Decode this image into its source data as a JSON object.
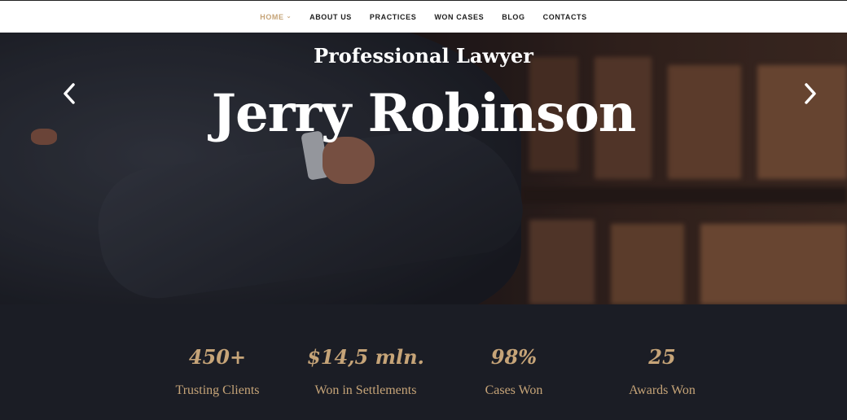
{
  "nav": {
    "items": [
      {
        "label": "HOME",
        "active": true,
        "has_dropdown": true
      },
      {
        "label": "ABOUT US",
        "active": false
      },
      {
        "label": "PRACTICES",
        "active": false
      },
      {
        "label": "WON CASES",
        "active": false
      },
      {
        "label": "BLOG",
        "active": false
      },
      {
        "label": "CONTACTS",
        "active": false
      }
    ]
  },
  "hero": {
    "subtitle": "Professional Lawyer",
    "title": "Jerry Robinson",
    "prev_icon": "chevron-left-icon",
    "next_icon": "chevron-right-icon"
  },
  "stats": [
    {
      "value": "450+",
      "label": "Trusting Clients"
    },
    {
      "value": "$14,5 mln.",
      "label": "Won in Settlements"
    },
    {
      "value": "98%",
      "label": "Cases Won"
    },
    {
      "value": "25",
      "label": "Awards Won"
    }
  ],
  "colors": {
    "accent": "#c6a478",
    "dark": "#1b1d25",
    "white": "#ffffff"
  }
}
